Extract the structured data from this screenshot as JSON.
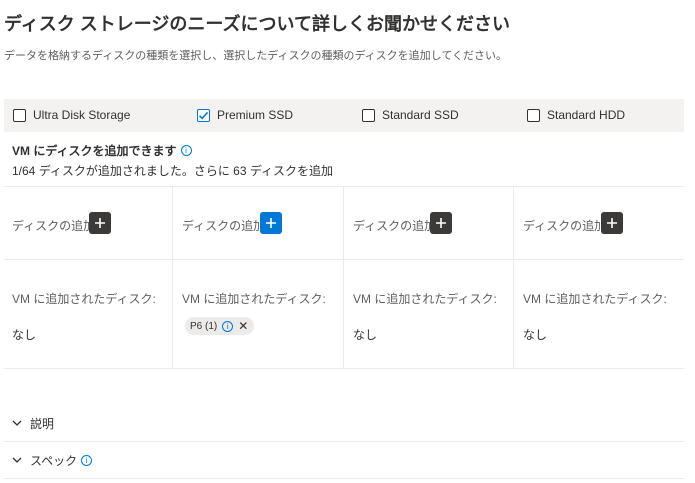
{
  "header": {
    "title": "ディスク ストレージのニーズについて詳しくお聞かせください",
    "subtitle": "データを格納するディスクの種類を選択し、選択したディスクの種類のディスクを追加してください。"
  },
  "disk_types": [
    {
      "label": "Ultra Disk Storage",
      "checked": false
    },
    {
      "label": "Premium SSD",
      "checked": true
    },
    {
      "label": "Standard SSD",
      "checked": false
    },
    {
      "label": "Standard HDD",
      "checked": false
    }
  ],
  "vm": {
    "heading": "VM にディスクを追加できます",
    "count_text": "1/64 ディスクが追加されました。さらに 63 ディスクを追加"
  },
  "columns": [
    {
      "add_label": "ディスクの追加",
      "added_label": "VM に追加されたディスク:",
      "value": "なし"
    },
    {
      "add_label": "ディスクの追加",
      "added_label": "VM に追加されたディスク:",
      "chip": "P6 (1)"
    },
    {
      "add_label": "ディスクの追加",
      "added_label": "VM に追加されたディスク:",
      "value": "なし"
    },
    {
      "add_label": "ディスクの追加",
      "added_label": "VM に追加されたディスク:",
      "value": "なし"
    }
  ],
  "sections": [
    {
      "label": "説明"
    },
    {
      "label": "スペック"
    }
  ],
  "icons": {
    "info": "info-icon",
    "add": "plus-icon",
    "chevron": "chevron-down-icon",
    "check": "checkmark-icon",
    "close": "close-icon"
  },
  "colors": {
    "accent": "#0078d4",
    "dark_button": "#3b3a39",
    "bar_background": "#f3f2f1"
  }
}
